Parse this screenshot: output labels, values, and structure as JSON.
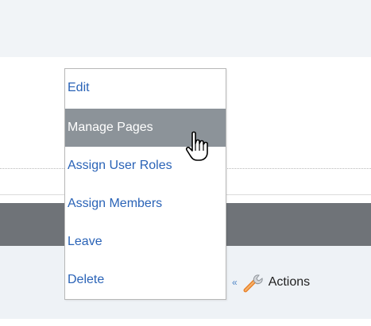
{
  "menu": {
    "items": [
      {
        "label": "Edit"
      },
      {
        "label": "Manage Pages",
        "highlighted": true
      },
      {
        "label": "Assign User Roles"
      },
      {
        "label": "Assign Members"
      },
      {
        "label": "Leave"
      },
      {
        "label": "Delete"
      }
    ]
  },
  "actions": {
    "label": "Actions",
    "chevron_icon": "double-chevron-left-icon",
    "wrench_icon": "wrench-icon"
  },
  "cursor": {
    "icon": "hand-pointer-icon"
  },
  "colors": {
    "link": "#2a63b7",
    "highlight_bg": "#8c9399",
    "dark_bar": "#6f7378",
    "light_band": "#eef2f6"
  }
}
